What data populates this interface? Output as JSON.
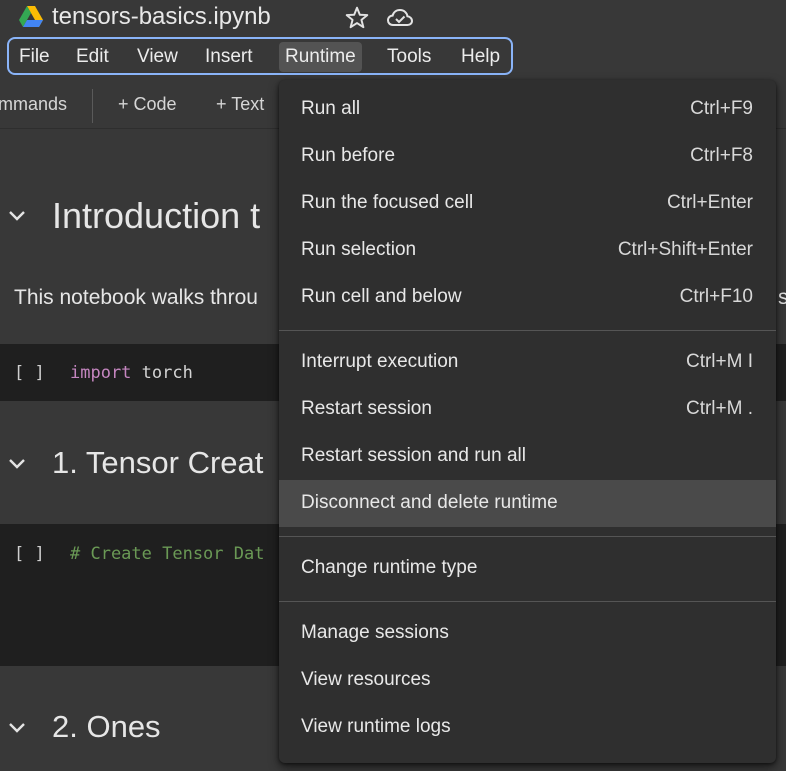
{
  "app": {
    "notebook_title": "tensors-basics.ipynb",
    "icons": {
      "logo": "google-drive-icon",
      "star": "star-icon",
      "cloud": "cloud-saved-icon"
    }
  },
  "menubar": {
    "items": [
      "File",
      "Edit",
      "View",
      "Insert",
      "Runtime",
      "Tools",
      "Help"
    ],
    "active": "Runtime"
  },
  "toolbar": {
    "commands_label": "mmands",
    "add_code_label": "+ Code",
    "add_text_label": "+ Text"
  },
  "notebook": {
    "section1_title": "Introduction t",
    "intro_text_left": "This notebook walks throu",
    "intro_text_right": "s",
    "cell1_run": "[ ]",
    "cell1_keyword": "import",
    "cell1_module": "torch",
    "section2_title": "1. Tensor Creat",
    "cell2_run": "[ ]",
    "cell2_comment": "# Create Tensor Dat",
    "section3_title": "2. Ones"
  },
  "runtime_menu": {
    "groups": [
      [
        {
          "label": "Run all",
          "shortcut": "Ctrl+F9"
        },
        {
          "label": "Run before",
          "shortcut": "Ctrl+F8"
        },
        {
          "label": "Run the focused cell",
          "shortcut": "Ctrl+Enter"
        },
        {
          "label": "Run selection",
          "shortcut": "Ctrl+Shift+Enter"
        },
        {
          "label": "Run cell and below",
          "shortcut": "Ctrl+F10"
        }
      ],
      [
        {
          "label": "Interrupt execution",
          "shortcut": "Ctrl+M I"
        },
        {
          "label": "Restart session",
          "shortcut": "Ctrl+M ."
        },
        {
          "label": "Restart session and run all",
          "shortcut": ""
        },
        {
          "label": "Disconnect and delete runtime",
          "shortcut": ""
        }
      ],
      [
        {
          "label": "Change runtime type",
          "shortcut": ""
        }
      ],
      [
        {
          "label": "Manage sessions",
          "shortcut": ""
        },
        {
          "label": "View resources",
          "shortcut": ""
        },
        {
          "label": "View runtime logs",
          "shortcut": ""
        }
      ]
    ],
    "highlighted": "Disconnect and delete runtime"
  },
  "colors": {
    "background": "#383838",
    "menu_background": "#2f2f2f",
    "focus_border": "#8ab4f8",
    "code_keyword": "#c586c0",
    "code_comment": "#6a9955"
  }
}
